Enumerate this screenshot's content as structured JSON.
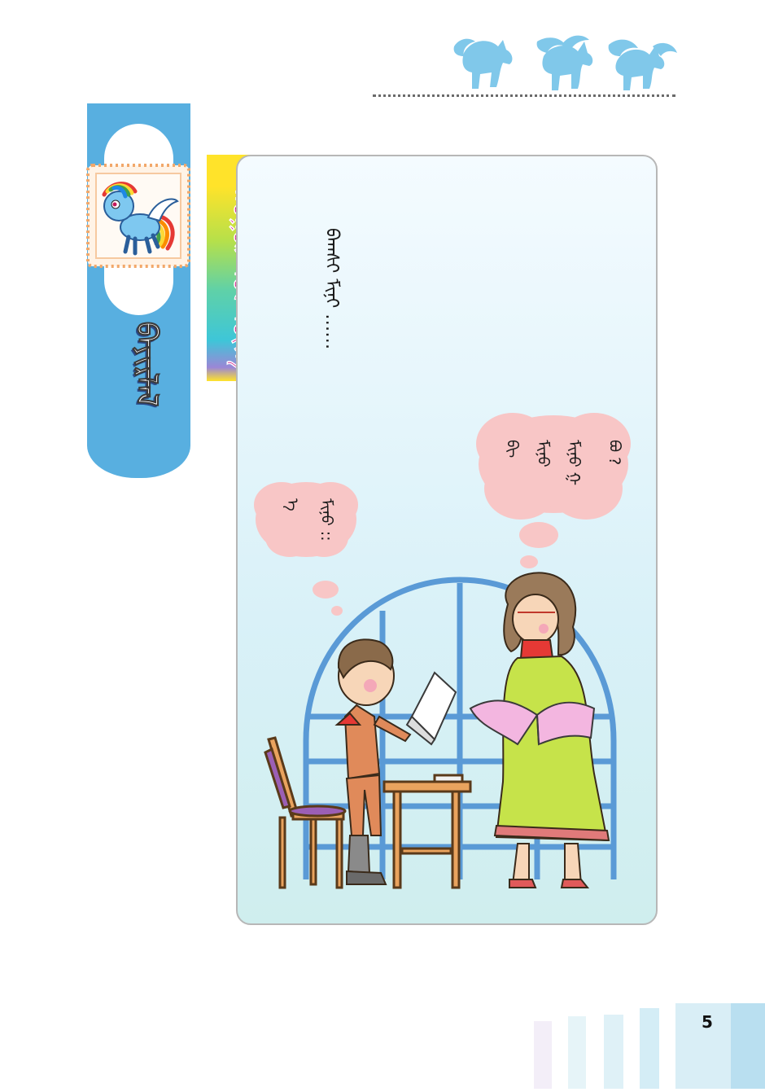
{
  "header": {
    "decoration_icon": "three-pony-silhouettes-icon",
    "accent_color": "#7fc9ea"
  },
  "sidebar": {
    "title": "ᠪᠠᠶᠢᠷᠯᠠᠯ",
    "stamp_icon": "rainbow-pony-stamp-icon",
    "color": "#58afe0"
  },
  "lesson": {
    "label": "ᠬᠤᠭᠤᠷ ᠤᠨ ᠦᠭᠡ"
  },
  "panel": {
    "intro_text": "ᠪᠠᠭᠰᠢ ᠮᠢᠨᠢ ……",
    "teacher_bubble_lines": [
      "ᠪᠢ",
      "ᠮᠢᠨᠤ",
      "ᠮᠢᠨᠦ ᠭ",
      "ᠪᠣ ?"
    ],
    "boy_bubble_lines": [
      "ᠡ",
      "ᠮᠢᠨᠤ ::"
    ]
  },
  "page": {
    "number": "5"
  }
}
